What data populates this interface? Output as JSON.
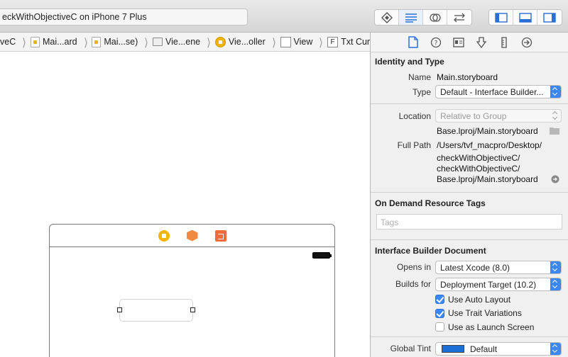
{
  "toolbar": {
    "scheme": "eckWithObjectiveC on iPhone 7 Plus"
  },
  "jumpbar": {
    "items": [
      {
        "label": "veC"
      },
      {
        "label": "Mai...ard"
      },
      {
        "label": "Mai...se)"
      },
      {
        "label": "Vie...ene"
      },
      {
        "label": "Vie...oller"
      },
      {
        "label": "View"
      },
      {
        "label": "Txt Current",
        "icon_letter": "F"
      }
    ]
  },
  "inspector": {
    "identity": {
      "title": "Identity and Type",
      "name_label": "Name",
      "name_value": "Main.storyboard",
      "type_label": "Type",
      "type_value": "Default - Interface Builder...",
      "location_label": "Location",
      "location_value": "Relative to Group",
      "location_path": "Base.lproj/Main.storyboard",
      "full_path_label": "Full Path",
      "full_path_lines": [
        "/Users/tvf_macpro/Desktop/",
        "checkWithObjectiveC/",
        "checkWithObjectiveC/",
        "Base.lproj/Main.storyboard"
      ]
    },
    "on_demand": {
      "title": "On Demand Resource Tags",
      "tags_placeholder": "Tags"
    },
    "ib_document": {
      "title": "Interface Builder Document",
      "opens_in_label": "Opens in",
      "opens_in_value": "Latest Xcode (8.0)",
      "builds_for_label": "Builds for",
      "builds_for_value": "Deployment Target (10.2)",
      "use_auto_layout": {
        "label": "Use Auto Layout",
        "checked": true
      },
      "use_trait_variations": {
        "label": "Use Trait Variations",
        "checked": true
      },
      "use_as_launch_screen": {
        "label": "Use as Launch Screen",
        "checked": false
      },
      "global_tint_label": "Global Tint",
      "global_tint_value": "Default",
      "global_tint_color": "#1d6fd8"
    }
  },
  "colors": {
    "accent": "#3b87f4",
    "scene_icon_yellow": "#f5b400",
    "scene_icon_orange": "#f08a40"
  }
}
